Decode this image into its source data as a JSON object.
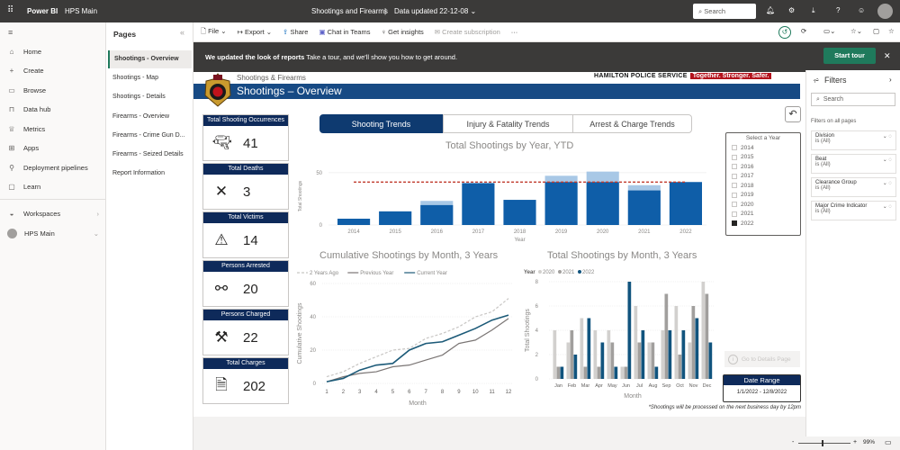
{
  "topbar": {
    "app": "Power BI",
    "workspace": "HPS Main",
    "report_title": "Shootings and Firearms",
    "separator": "|",
    "data_updated": "Data updated 22-12-08",
    "search_placeholder": "Search"
  },
  "leftnav": {
    "items": [
      {
        "label": "Home",
        "icon": "home-icon"
      },
      {
        "label": "Create",
        "icon": "plus-icon"
      },
      {
        "label": "Browse",
        "icon": "folder-icon"
      },
      {
        "label": "Data hub",
        "icon": "cylinder-icon"
      },
      {
        "label": "Metrics",
        "icon": "trophy-icon"
      },
      {
        "label": "Apps",
        "icon": "grid-icon"
      },
      {
        "label": "Deployment pipelines",
        "icon": "rocket-icon"
      },
      {
        "label": "Learn",
        "icon": "book-icon"
      }
    ],
    "workspaces": "Workspaces",
    "current_workspace": "HPS Main"
  },
  "pages": {
    "title": "Pages",
    "items": [
      "Shootings - Overview",
      "Shootings - Map",
      "Shootings - Details",
      "Firearms - Overview",
      "Firearms - Crime Gun D...",
      "Firearms - Seized Details",
      "Report Information"
    ],
    "active": 0
  },
  "toolbar": {
    "file": "File",
    "export": "Export",
    "share": "Share",
    "chat": "Chat in Teams",
    "insights": "Get insights",
    "subscription": "Create subscription",
    "more": "···"
  },
  "banner": {
    "bold": "We updated the look of reports",
    "text": "Take a tour, and we'll show you how to get around.",
    "button": "Start tour"
  },
  "report": {
    "subtitle": "Shootings & Firearms",
    "title": "Shootings – Overview",
    "brand": "HAMILTON POLICE SERVICE",
    "slogan": "Together. Stronger. Safer.",
    "kpis": [
      {
        "label": "Total Shooting Occurrences",
        "value": "41",
        "icon": "gun-icon"
      },
      {
        "label": "Total Deaths",
        "value": "3",
        "icon": "x-icon"
      },
      {
        "label": "Total Victims",
        "value": "14",
        "icon": "warning-icon"
      },
      {
        "label": "Persons Arrested",
        "value": "20",
        "icon": "handcuffs-icon"
      },
      {
        "label": "Persons Charged",
        "value": "22",
        "icon": "gavel-icon"
      },
      {
        "label": "Total Charges",
        "value": "202",
        "icon": "document-icon"
      }
    ],
    "tabs": [
      "Shooting Trends",
      "Injury & Fatality Trends",
      "Arrest & Charge Trends"
    ],
    "active_tab": 0,
    "year_slicer": {
      "title": "Select a Year",
      "options": [
        "2014",
        "2015",
        "2016",
        "2017",
        "2018",
        "2019",
        "2020",
        "2021",
        "2022"
      ],
      "selected": "2022"
    },
    "details_button": "Go to Details Page",
    "date_range": {
      "label": "Date Range",
      "value": "1/1/2022 - 12/8/2022"
    },
    "footnote": "*Shootings will be processed on the next business day by 12pm"
  },
  "chart_data": [
    {
      "type": "bar",
      "title": "Total Shootings by Year, YTD",
      "xlabel": "Year",
      "ylabel": "Total Shootings",
      "categories": [
        "2014",
        "2015",
        "2016",
        "2017",
        "2018",
        "2019",
        "2020",
        "2021",
        "2022"
      ],
      "ylim": [
        0,
        55
      ],
      "yticks": [
        0,
        50
      ],
      "series": [
        {
          "values": [
            6,
            13,
            19,
            40,
            24,
            41,
            41,
            33,
            41
          ],
          "color": "#0f5ea8"
        },
        {
          "values": [
            6,
            13,
            23,
            40,
            24,
            47,
            51,
            38,
            41
          ],
          "color": "#a8c8e6"
        }
      ],
      "reference_line": {
        "value": 41,
        "color": "#c0392b",
        "style": "dashed"
      }
    },
    {
      "type": "line",
      "title": "Cumulative Shootings by Month, 3 Years",
      "xlabel": "Month",
      "ylabel": "Cumulative Shootings",
      "x": [
        1,
        2,
        3,
        4,
        5,
        6,
        7,
        8,
        9,
        10,
        11,
        12
      ],
      "ylim": [
        0,
        60
      ],
      "yticks": [
        0,
        20,
        40,
        60
      ],
      "legend": "top-left",
      "series": [
        {
          "name": "2 Years Ago",
          "values": [
            4,
            7,
            12,
            16,
            20,
            21,
            27,
            30,
            34,
            40,
            43,
            51
          ],
          "color": "#c8c6c4",
          "style": "dashed"
        },
        {
          "name": "Previous Year",
          "values": [
            1,
            4,
            6,
            7,
            10,
            11,
            14,
            17,
            24,
            26,
            32,
            39
          ],
          "color": "#7a7574",
          "style": "solid"
        },
        {
          "name": "Current Year",
          "values": [
            1,
            3,
            8,
            11,
            12,
            20,
            24,
            25,
            29,
            33,
            38,
            41
          ],
          "color": "#1c5a78",
          "style": "solid"
        }
      ]
    },
    {
      "type": "bar",
      "title": "Total Shootings by Month, 3 Years",
      "xlabel": "Month",
      "ylabel": "Total Shootings",
      "legend_title": "Year",
      "legend": "top-left",
      "categories": [
        "Jan",
        "Feb",
        "Mar",
        "Apr",
        "May",
        "Jun",
        "Jul",
        "Aug",
        "Sep",
        "Oct",
        "Nov",
        "Dec"
      ],
      "ylim": [
        0,
        8
      ],
      "yticks": [
        0,
        2,
        4,
        6,
        8
      ],
      "series": [
        {
          "name": "2020",
          "values": [
            4,
            3,
            5,
            4,
            4,
            1,
            6,
            3,
            4,
            6,
            3,
            8
          ],
          "color": "#d2d0ce"
        },
        {
          "name": "2021",
          "values": [
            1,
            4,
            1,
            1,
            3,
            1,
            3,
            3,
            7,
            2,
            6,
            7
          ],
          "color": "#a19f9d"
        },
        {
          "name": "2022",
          "values": [
            1,
            2,
            5,
            3,
            1,
            8,
            4,
            1,
            4,
            4,
            5,
            3
          ],
          "color": "#11547e"
        }
      ]
    }
  ],
  "filters": {
    "title": "Filters",
    "search_placeholder": "Search",
    "section": "Filters on all pages",
    "items": [
      {
        "name": "Division",
        "value": "is (All)"
      },
      {
        "name": "Beat",
        "value": "is (All)"
      },
      {
        "name": "Clearance Group",
        "value": "is (All)"
      },
      {
        "name": "Major Crime Indicator",
        "value": "is (All)"
      }
    ]
  },
  "status": {
    "zoom": "99%",
    "zoom_minus": "-",
    "zoom_plus": "+"
  }
}
